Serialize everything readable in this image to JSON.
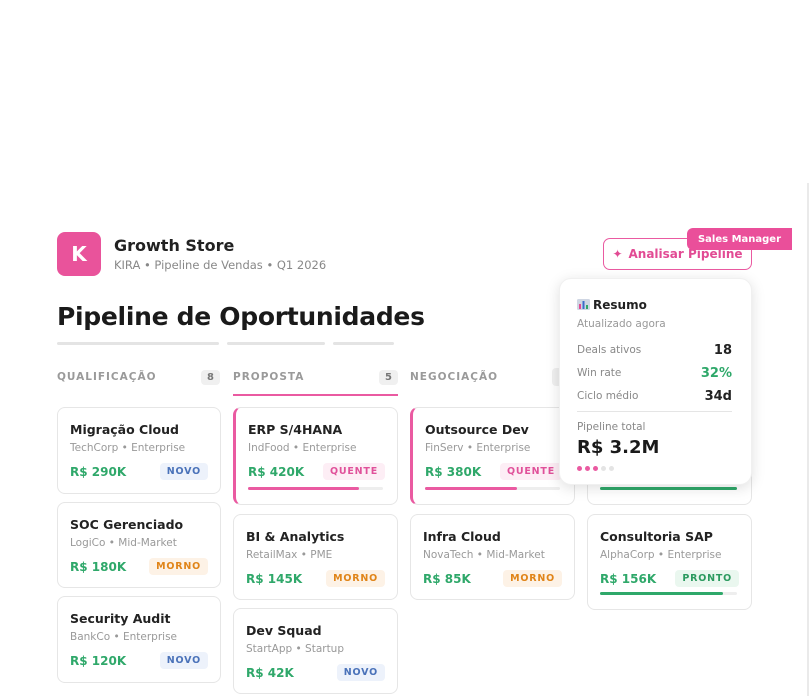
{
  "header": {
    "logo_letter": "K",
    "brand": "Growth Store",
    "subtitle": "KIRA • Pipeline de Vendas • Q1 2026",
    "analyze_icon": "sparkle-icon",
    "analyze_label": "Analisar Pipeline",
    "role_badge": "Sales Manager"
  },
  "page_title": "Pipeline de Oportunidades",
  "columns": [
    {
      "name": "QUALIFICAÇÃO",
      "count": "8"
    },
    {
      "name": "PROPOSTA",
      "count": "5"
    },
    {
      "name": "NEGOCIAÇÃO",
      "count": ""
    }
  ],
  "cards": {
    "q1": {
      "title": "Migração Cloud",
      "sub": "TechCorp • Enterprise",
      "value": "R$ 290K",
      "tag": "NOVO"
    },
    "q2": {
      "title": "SOC Gerenciado",
      "sub": "LogiCo • Mid-Market",
      "value": "R$ 180K",
      "tag": "MORNO"
    },
    "q3": {
      "title": "Security Audit",
      "sub": "BankCo • Enterprise",
      "value": "R$ 120K",
      "tag": "NOVO"
    },
    "p1": {
      "title": "ERP S/4HANA",
      "sub": "IndFood • Enterprise",
      "value": "R$ 420K",
      "tag": "QUENTE",
      "progress": 0.82
    },
    "p2": {
      "title": "BI & Analytics",
      "sub": "RetailMax • PME",
      "value": "R$ 145K",
      "tag": "MORNO"
    },
    "p3": {
      "title": "Dev Squad",
      "sub": "StartApp • Startup",
      "value": "R$ 42K",
      "tag": "NOVO"
    },
    "n1": {
      "title": "Outsource Dev",
      "sub": "FinServ • Enterprise",
      "value": "R$ 380K",
      "tag": "QUENTE",
      "progress": 0.68
    },
    "n2": {
      "title": "Infra Cloud",
      "sub": "NovaTech • Mid-Market",
      "value": "R$ 85K",
      "tag": "MORNO"
    },
    "f1": {
      "progress": 1.0
    },
    "f2": {
      "title": "Consultoria SAP",
      "sub": "AlphaCorp • Enterprise",
      "value": "R$ 156K",
      "tag": "PRONTO",
      "progress": 0.9
    }
  },
  "colors": {
    "accent": "#ea5aa1",
    "green": "#2fa86a"
  },
  "summary": {
    "icon": "chart-icon",
    "title": "Resumo",
    "updated": "Atualizado agora",
    "deals_label": "Deals ativos",
    "deals_value": "18",
    "winrate_label": "Win rate",
    "winrate_value": "32%",
    "cycle_label": "Ciclo médio",
    "cycle_value": "34d",
    "total_label": "Pipeline total",
    "total_value": "R$ 3.2M"
  }
}
